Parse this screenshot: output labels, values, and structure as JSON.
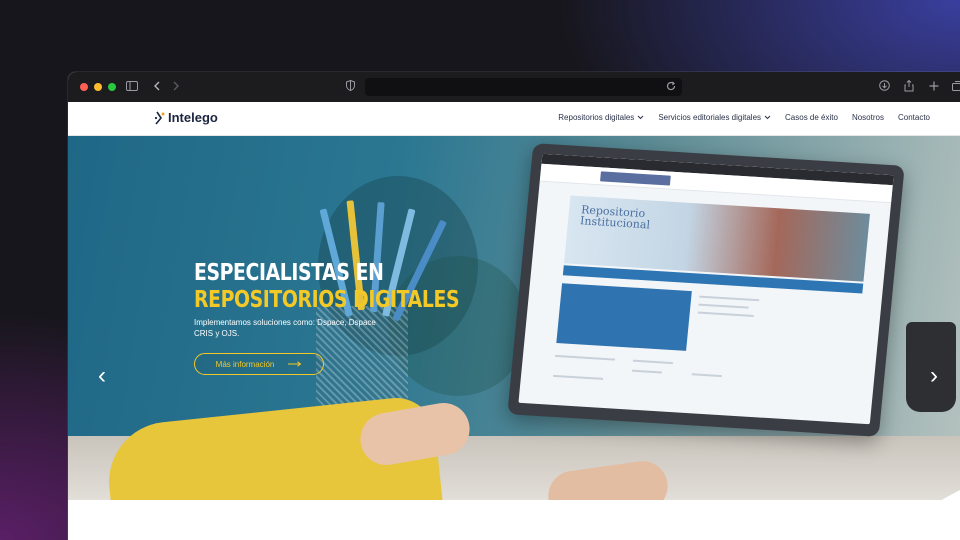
{
  "browser": {
    "traffic_lights": [
      "#ff5f57",
      "#febc2e",
      "#28c840"
    ],
    "icons": [
      "sidebar-icon",
      "back-icon",
      "forward-icon",
      "shield-icon",
      "reload-icon",
      "download-icon",
      "share-icon",
      "new-tab-icon",
      "tabs-icon"
    ]
  },
  "site": {
    "logo_text": "Intelego",
    "nav": [
      {
        "label": "Repositorios digitales",
        "has_dropdown": true
      },
      {
        "label": "Servicios editoriales digitales",
        "has_dropdown": true
      },
      {
        "label": "Casos de éxito",
        "has_dropdown": false
      },
      {
        "label": "Nosotros",
        "has_dropdown": false
      },
      {
        "label": "Contacto",
        "has_dropdown": false
      }
    ]
  },
  "hero": {
    "title_line1": "ESPECIALISTAS EN",
    "title_line2": "REPOSITORIOS DIGITALES",
    "subtitle": "Implementamos soluciones como: Dspace, Dspace CRIS y OJS.",
    "cta_label": "Más información",
    "accent_color": "#f3c928",
    "prev_arrow": "‹",
    "next_arrow": "›"
  },
  "laptop_screen": {
    "hero_title": "Repositorio Institucional"
  }
}
